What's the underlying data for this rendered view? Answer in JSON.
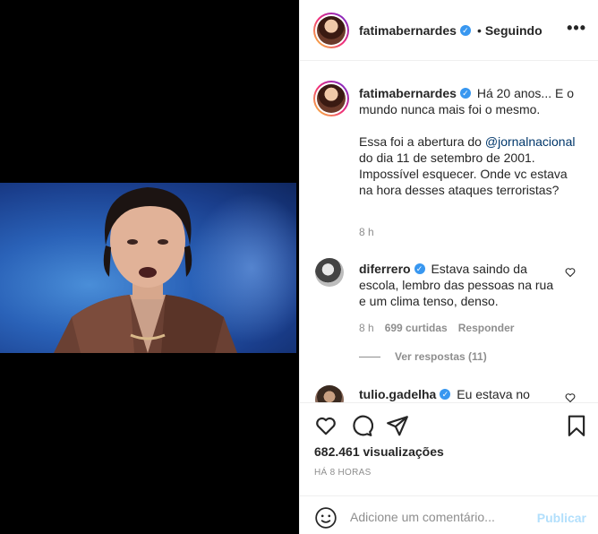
{
  "post": {
    "username": "fatimabernardes",
    "following_label": "Seguindo",
    "more_label": "•••"
  },
  "caption": {
    "username": "fatimabernardes",
    "line1": "Há 20 anos... E o mundo nunca mais foi o mesmo.",
    "line2_prefix": "Essa foi a abertura do ",
    "mention": "@jornalnacional",
    "line2_suffix": " do dia 11 de setembro de 2001. Impossível esquecer.",
    "line3": "Onde vc estava na hora desses ataques terroristas?",
    "time": "8 h"
  },
  "comments": [
    {
      "username": "diferrero",
      "text": "Estava saindo da escola, lembro das pessoas na rua e um clima tenso, denso.",
      "time": "8 h",
      "likes": "699 curtidas",
      "reply_label": "Responder",
      "view_replies": "Ver respostas (11)"
    },
    {
      "username": "tulio.gadelha",
      "text": "Eu estava no"
    }
  ],
  "stats": {
    "views": "682.461 visualizações",
    "posted_ago": "HÁ 8 HORAS"
  },
  "comment_box": {
    "placeholder": "Adicione um comentário...",
    "publish_label": "Publicar"
  },
  "icons": {
    "like": "heart-icon",
    "comment": "comment-icon",
    "share": "send-icon",
    "save": "bookmark-icon",
    "emoji": "smiley-icon",
    "verified": "verified-badge-icon",
    "more": "more-options-icon"
  },
  "colors": {
    "verified": "#3897f0",
    "mention": "#00376b",
    "publish_disabled": "#b2dffc",
    "muted": "#8e8e8e"
  }
}
